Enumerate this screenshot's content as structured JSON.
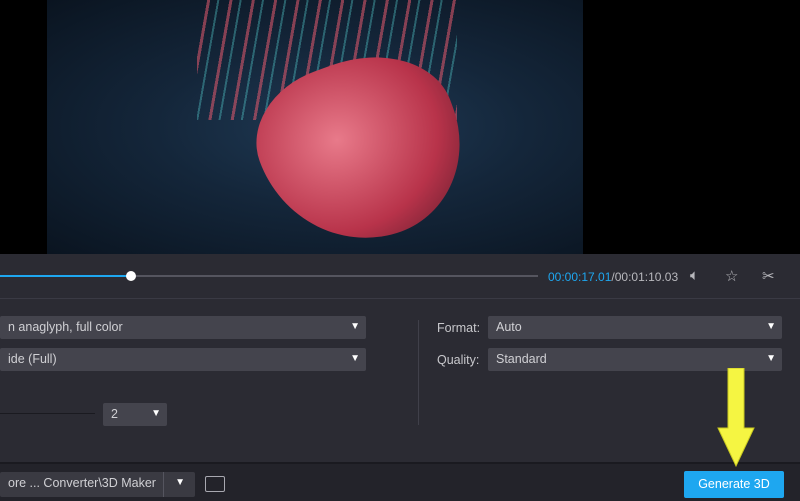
{
  "player": {
    "current_time": "00:00:17.01",
    "separator": "/",
    "total_time": "00:01:10.03",
    "progress_percent": 24.3
  },
  "settings": {
    "anaglyph_value": "n anaglyph, full color",
    "split_value": "ide (Full)",
    "depth_value": "2",
    "format_label": "Format:",
    "format_value": "Auto",
    "quality_label": "Quality:",
    "quality_value": "Standard"
  },
  "bottom": {
    "output_path": "ore ... Converter\\3D Maker",
    "generate_label": "Generate 3D"
  },
  "colors": {
    "accent": "#1ea7f0",
    "annotation_arrow": "#f5f542"
  }
}
